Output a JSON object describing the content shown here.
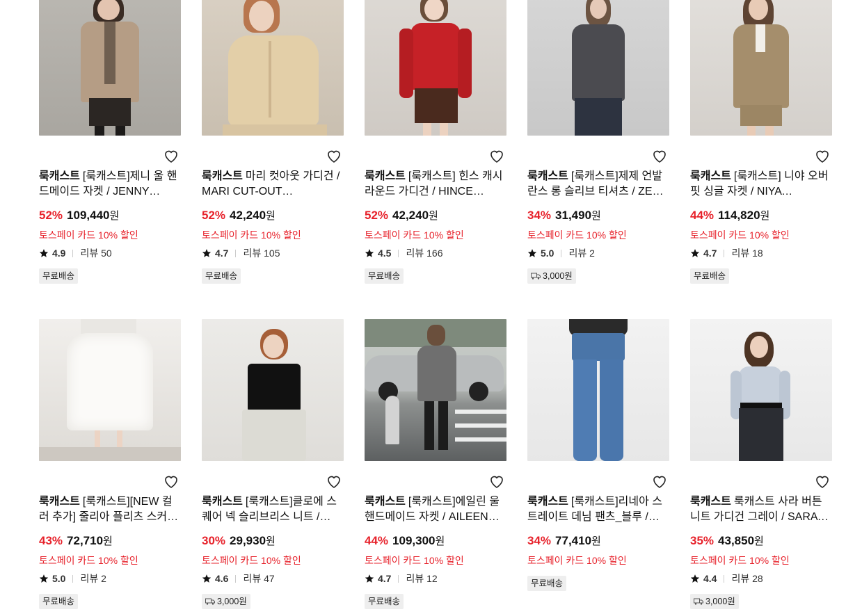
{
  "products": [
    {
      "brand": "룩캐스트",
      "name": "[룩캐스트]제니 울 핸드메이드 자켓 / JENNY WOOL HANDMADE JACKET",
      "discount": "52%",
      "price": "109,440",
      "won": "원",
      "promo": "토스페이 카드 10% 할인",
      "rating": "4.9",
      "review_label": "리뷰",
      "reviews": "50",
      "shipping": "무료배송",
      "shipping_type": "free"
    },
    {
      "brand": "룩캐스트",
      "name": "마리 컷아웃 가디건 / MARI CUT-OUT CARDIGAN",
      "discount": "52%",
      "price": "42,240",
      "won": "원",
      "promo": "토스페이 카드 10% 할인",
      "rating": "4.7",
      "review_label": "리뷰",
      "reviews": "105",
      "shipping": "무료배송",
      "shipping_type": "free"
    },
    {
      "brand": "룩캐스트",
      "name": "[룩캐스트] 힌스 캐시라운드 가디건 / HINCE CASHMERE ROUND CARDIGAN",
      "discount": "52%",
      "price": "42,240",
      "won": "원",
      "promo": "토스페이 카드 10% 할인",
      "rating": "4.5",
      "review_label": "리뷰",
      "reviews": "166",
      "shipping": "무료배송",
      "shipping_type": "free"
    },
    {
      "brand": "룩캐스트",
      "name": "[룩캐스트]제제 언발란스 롱 슬리브 티셔츠 / ZEZE UNBALANCE LONG SLEEVE",
      "discount": "34%",
      "price": "31,490",
      "won": "원",
      "promo": "토스페이 카드 10% 할인",
      "rating": "5.0",
      "review_label": "리뷰",
      "reviews": "2",
      "shipping": "3,000원",
      "shipping_type": "paid"
    },
    {
      "brand": "룩캐스트",
      "name": "[룩캐스트] 니야 오버핏 싱글 자켓 / NIYA OVERFIT SINGLE JACKET",
      "discount": "44%",
      "price": "114,820",
      "won": "원",
      "promo": "토스페이 카드 10% 할인",
      "rating": "4.7",
      "review_label": "리뷰",
      "reviews": "18",
      "shipping": "무료배송",
      "shipping_type": "free"
    },
    {
      "brand": "룩캐스트",
      "name": "[룩캐스트][NEW 컬러 추가] 줄리아 플리츠 스커트 / JULIA PLEATS SKIRT",
      "discount": "43%",
      "price": "72,710",
      "won": "원",
      "promo": "토스페이 카드 10% 할인",
      "rating": "5.0",
      "review_label": "리뷰",
      "reviews": "2",
      "shipping": "무료배송",
      "shipping_type": "free"
    },
    {
      "brand": "룩캐스트",
      "name": "[룩캐스트]클로에 스퀘어 넥 슬리브리스 니트 / CHLOE SQUARE NECK",
      "discount": "30%",
      "price": "29,930",
      "won": "원",
      "promo": "토스페이 카드 10% 할인",
      "rating": "4.6",
      "review_label": "리뷰",
      "reviews": "47",
      "shipping": "3,000원",
      "shipping_type": "paid"
    },
    {
      "brand": "룩캐스트",
      "name": "[룩캐스트]에일린 울 핸드메이드 자켓 / AILEEN WOOL HANDMADE JACKET",
      "discount": "44%",
      "price": "109,300",
      "won": "원",
      "promo": "토스페이 카드 10% 할인",
      "rating": "4.7",
      "review_label": "리뷰",
      "reviews": "12",
      "shipping": "무료배송",
      "shipping_type": "free"
    },
    {
      "brand": "룩캐스트",
      "name": "[룩캐스트]리네아 스트레이트 데님 팬츠_블루 / LINEA STRAIGHT DENIM",
      "discount": "34%",
      "price": "77,410",
      "won": "원",
      "promo": "토스페이 카드 10% 할인",
      "rating": "",
      "review_label": "",
      "reviews": "",
      "shipping": "무료배송",
      "shipping_type": "free"
    },
    {
      "brand": "룩캐스트",
      "name": "룩캐스트 사라 버튼 니트 가디건 그레이 / SARA BUTTON KNIT CARDIGAN",
      "discount": "35%",
      "price": "43,850",
      "won": "원",
      "promo": "토스페이 카드 10% 할인",
      "rating": "4.4",
      "review_label": "리뷰",
      "reviews": "28",
      "shipping": "3,000원",
      "shipping_type": "paid"
    }
  ],
  "colors": {
    "accent": "#e7222b",
    "tag_bg": "#eeeeee"
  }
}
